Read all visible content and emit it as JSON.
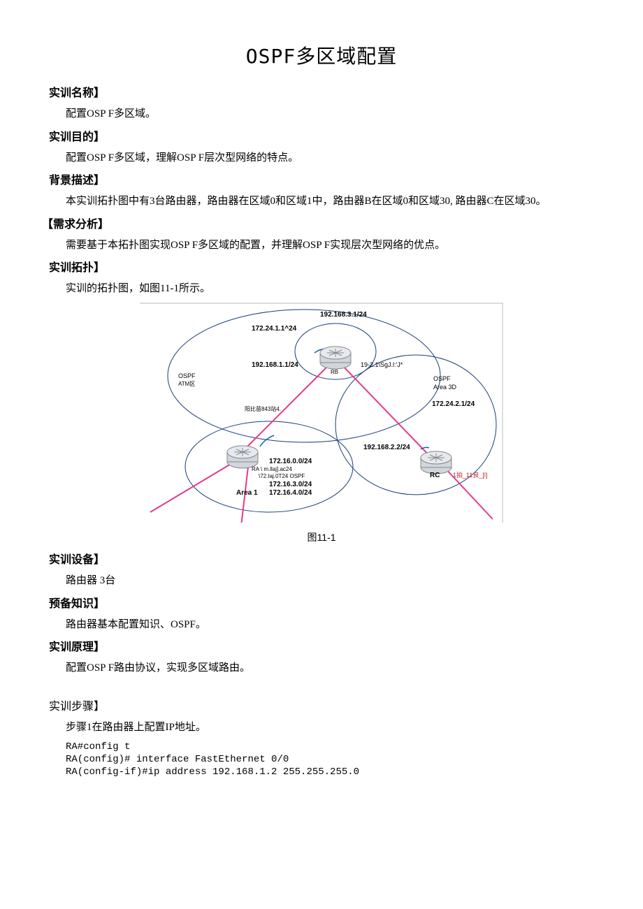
{
  "title": "OSPF多区域配置",
  "sections": {
    "name_h": "实训名称】",
    "name_b": "配置OSP F多区域。",
    "goal_h": "实训目的】",
    "goal_b": "配置OSP F多区域，理解OSP F层次型网络的特点。",
    "bg_h": "背景描述】",
    "bg_b": "本实训拓扑图中有3台路由器，路由器在区域0和区域1中，路由器B在区域0和区域30, 路由器C在区域30。",
    "req_h": "【需求分析】",
    "req_b": "需要基于本拓扑图实现OSP F多区域的配置，并理解OSP F实现层次型网络的优点。",
    "topo_h": "实训拓扑】",
    "topo_b": "实训的拓扑图，如图11-1所示。",
    "fig_caption": "图11-1",
    "equip_h": "实训设备】",
    "equip_b": "路由器  3台",
    "prep_h": "预备知识】",
    "prep_b": "路由器基本配置知识、OSPF。",
    "princ_h": "实训原理】",
    "princ_b": "配置OSP F路由协议，实现多区域路由。",
    "steps_h": "实训步骤】",
    "step1": "步骤1在路由器上配置IP地址。",
    "code1": "RA#config t\nRA(config)# interface FastEthernet 0/0\nRA(config-if)#ip address 192.168.1.2 255.255.255.0"
  },
  "diagram": {
    "ip_top": "192.168.3.1/24",
    "ip_172_24_1": "172.24.1.1^24",
    "ip_rb_left": "192.168.1.1/24",
    "rb_right": "19-2.1\\SgJ.l:'J*",
    "ospf": "OSPF",
    "area_atm": "ATM区",
    "area_3d": "Area 3D",
    "ip_172_24_2": "172.24.2.1/24",
    "mid_text": "阳比苗843站4.",
    "ip_192_168_2": "192.168.2.2/24",
    "ra_label": "RA \\ m.llaj].ac24",
    "ra_line2": "\\72.Iaj.0T24 OSPF",
    "ra_net1": "172.16.0.0/24",
    "ra_net3": "172.16.3.0/24",
    "ra_net4": "172.16.4.0/24",
    "area1": "Area 1",
    "rb": "RB",
    "rc": "RC",
    "rc_sub": "1拍_11良_[l]"
  }
}
